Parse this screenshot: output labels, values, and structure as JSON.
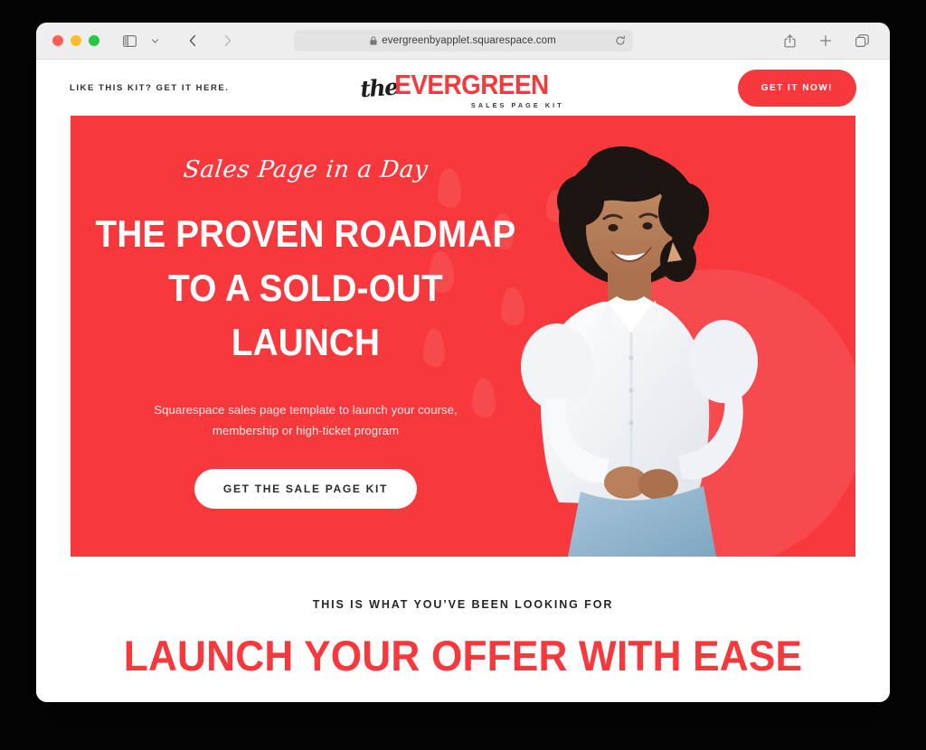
{
  "browser": {
    "window_controls": [
      "close",
      "minimize",
      "maximize"
    ],
    "sidebar_icon": "sidebar-icon",
    "dropdown_icon": "chevron-down-icon",
    "back_icon": "back-arrow-icon",
    "forward_icon": "forward-arrow-icon",
    "url": "evergreenbyapplet.squarespace.com",
    "lock_icon": "lock-icon",
    "reload_icon": "reload-icon",
    "share_icon": "share-icon",
    "new_tab_icon": "plus-icon",
    "tabs_icon": "tabs-overview-icon"
  },
  "site": {
    "header": {
      "kit_link": "LIKE THIS KIT? GET IT HERE.",
      "logo": {
        "script": "the",
        "main": "EVERGREEN",
        "sub": "SALES PAGE KIT"
      },
      "cta_label": "GET IT NOW!"
    },
    "hero": {
      "script": "Sales Page in a Day",
      "headline_line1": "THE PROVEN ROADMAP",
      "headline_line2": "TO A SOLD-OUT LAUNCH",
      "subhead_line1": "Squarespace sales page template to launch your course,",
      "subhead_line2": "membership or high-ticket program",
      "cta_label": "GET THE SALE PAGE KIT",
      "background_color": "#f7393d",
      "image_alt": "smiling-woman-white-blouse"
    },
    "section2": {
      "eyebrow": "THIS IS WHAT YOU’VE BEEN LOOKING FOR",
      "heading": "LAUNCH YOUR OFFER WITH EASE",
      "heading_color": "#f7393d"
    }
  }
}
